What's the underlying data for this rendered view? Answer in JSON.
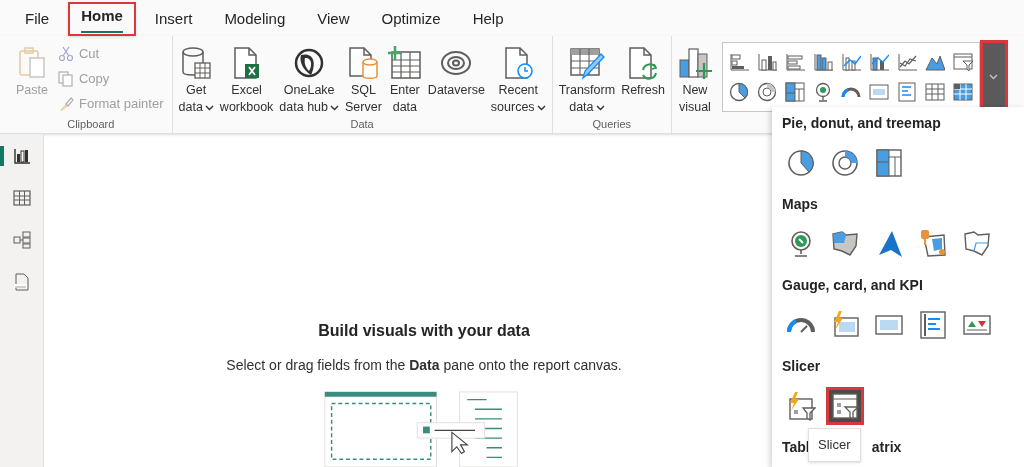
{
  "menu_tabs": [
    {
      "label": "File",
      "selected": false,
      "highlighted": false
    },
    {
      "label": "Home",
      "selected": true,
      "highlighted": true
    },
    {
      "label": "Insert",
      "selected": false,
      "highlighted": false
    },
    {
      "label": "Modeling",
      "selected": false,
      "highlighted": false
    },
    {
      "label": "View",
      "selected": false,
      "highlighted": false
    },
    {
      "label": "Optimize",
      "selected": false,
      "highlighted": false
    },
    {
      "label": "Help",
      "selected": false,
      "highlighted": false
    }
  ],
  "ribbon_groups": [
    {
      "label": "Clipboard",
      "buttons": [
        {
          "kind": "large",
          "lines": [
            "Paste"
          ],
          "dropdown": false,
          "disabled": true
        },
        {
          "kind": "small",
          "lines": [
            "Cut"
          ],
          "disabled": true
        },
        {
          "kind": "small",
          "lines": [
            "Copy"
          ],
          "disabled": true
        },
        {
          "kind": "small",
          "lines": [
            "Format painter"
          ],
          "disabled": true
        }
      ]
    },
    {
      "label": "Data",
      "buttons": [
        {
          "kind": "large",
          "lines": [
            "Get",
            "data"
          ],
          "dropdown": true,
          "disabled": false
        },
        {
          "kind": "large",
          "lines": [
            "Excel",
            "workbook"
          ],
          "dropdown": false,
          "disabled": false
        },
        {
          "kind": "large",
          "lines": [
            "OneLake",
            "data hub"
          ],
          "dropdown": true,
          "disabled": false
        },
        {
          "kind": "large",
          "lines": [
            "SQL",
            "Server"
          ],
          "dropdown": false,
          "disabled": false
        },
        {
          "kind": "large",
          "lines": [
            "Enter",
            "data"
          ],
          "dropdown": false,
          "disabled": false
        },
        {
          "kind": "large",
          "lines": [
            "Dataverse"
          ],
          "dropdown": false,
          "disabled": false
        },
        {
          "kind": "large",
          "lines": [
            "Recent",
            "sources"
          ],
          "dropdown": true,
          "disabled": false
        }
      ]
    },
    {
      "label": "Queries",
      "buttons": [
        {
          "kind": "large",
          "lines": [
            "Transform",
            "data"
          ],
          "dropdown": true,
          "disabled": false
        },
        {
          "kind": "large",
          "lines": [
            "Refresh"
          ],
          "dropdown": false,
          "disabled": false
        }
      ]
    },
    {
      "buttons": [
        {
          "kind": "large",
          "lines": [
            "New",
            "visual"
          ],
          "dropdown": false,
          "disabled": false
        }
      ]
    }
  ],
  "visual_gallery": {
    "expand_button": {
      "highlighted": true
    }
  },
  "side_nav": [
    {
      "selected": true
    },
    {
      "selected": false
    },
    {
      "selected": false
    },
    {
      "selected": false
    }
  ],
  "canvas": {
    "title": "Build visuals with your data",
    "subtitle": "Select or drag fields from the **Data** pane onto the report canvas."
  },
  "visuals_panel": {
    "sections": [
      {
        "title": "Pie, donut, and treemap",
        "items": [
          {
            "highlighted": false,
            "hovered": false
          },
          {
            "highlighted": false,
            "hovered": false
          },
          {
            "highlighted": false,
            "hovered": false
          }
        ]
      },
      {
        "title": "Maps",
        "items": [
          {
            "highlighted": false,
            "hovered": false
          },
          {
            "highlighted": false,
            "hovered": false
          },
          {
            "highlighted": false,
            "hovered": false
          },
          {
            "highlighted": false,
            "hovered": false
          },
          {
            "highlighted": false,
            "hovered": false
          }
        ]
      },
      {
        "title": "Gauge, card, and KPI",
        "items": [
          {
            "highlighted": false,
            "hovered": false
          },
          {
            "highlighted": false,
            "hovered": false
          },
          {
            "highlighted": false,
            "hovered": false
          },
          {
            "highlighted": false,
            "hovered": false
          },
          {
            "highlighted": false,
            "hovered": false
          }
        ]
      },
      {
        "title": "Slicer",
        "items": [
          {
            "highlighted": false,
            "hovered": false
          },
          {
            "highlighted": true,
            "hovered": true
          }
        ]
      },
      {
        "title_parts": [
          "Tabl",
          "atrix"
        ]
      }
    ],
    "tooltip": "Slicer"
  }
}
